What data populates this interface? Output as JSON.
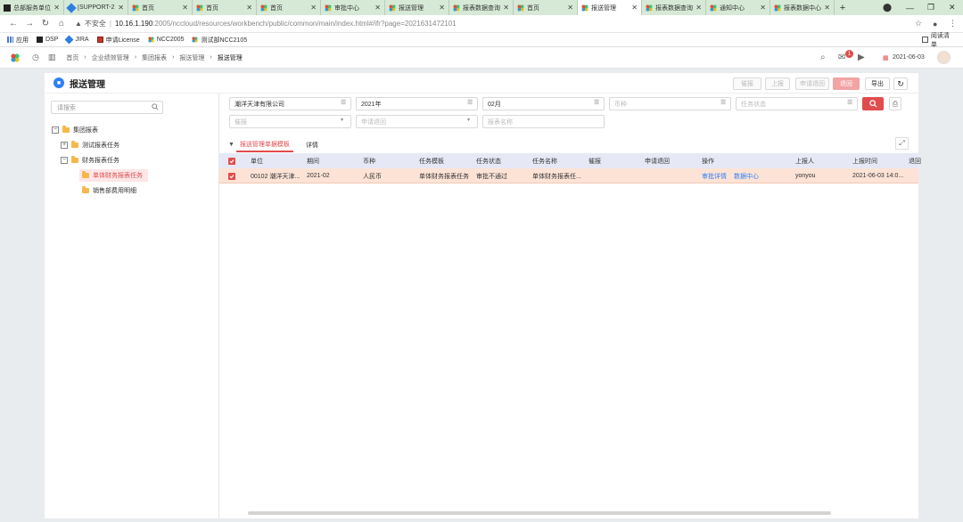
{
  "browser": {
    "tabs": [
      {
        "label": "总部服务单位",
        "icon": "dark-app-icon",
        "active": false
      },
      {
        "label": "[SUPPORT-2",
        "icon": "jira-icon",
        "active": false
      },
      {
        "label": "首页",
        "icon": "ncc-flower-icon",
        "active": false
      },
      {
        "label": "首页",
        "icon": "ncc-flower-icon",
        "active": false
      },
      {
        "label": "首页",
        "icon": "ncc-flower-icon",
        "active": false
      },
      {
        "label": "审批中心",
        "icon": "ncc-flower-icon",
        "active": false
      },
      {
        "label": "报送管理",
        "icon": "ncc-flower-icon",
        "active": false
      },
      {
        "label": "报表数据查询",
        "icon": "ncc-flower-icon",
        "active": false
      },
      {
        "label": "首页",
        "icon": "ncc-flower-icon",
        "active": false
      },
      {
        "label": "报送管理",
        "icon": "ncc-flower-icon",
        "active": true
      },
      {
        "label": "报表数据查询",
        "icon": "ncc-flower-icon",
        "active": false
      },
      {
        "label": "通知中心",
        "icon": "ncc-flower-icon",
        "active": false
      },
      {
        "label": "报表数据中心",
        "icon": "ncc-flower-icon",
        "active": false
      }
    ],
    "address": {
      "security_label": "不安全",
      "host": "10.16.1.190",
      "path": ":2005/nccloud/resources/workbench/public/common/main/index.html#/ifr?page=2021631472101"
    },
    "bookmarks": [
      {
        "label": "应用",
        "icon": "apps-grid-icon"
      },
      {
        "label": "DSP",
        "icon": "dark-app-icon"
      },
      {
        "label": "JIRA",
        "icon": "jira-icon"
      },
      {
        "label": "申请License",
        "icon": "license-icon"
      },
      {
        "label": "NCC2005",
        "icon": "ncc-flower-icon"
      },
      {
        "label": "测试部NCC2105",
        "icon": "ncc-flower-icon"
      }
    ],
    "reading_list": "阅读清单"
  },
  "app_header": {
    "breadcrumbs": [
      "首页",
      "企业绩效管理",
      "集团报表",
      "报送管理",
      "报送管理"
    ],
    "notification_count": "1",
    "date": "2021-06-03"
  },
  "page": {
    "title": "报送管理",
    "buttons": {
      "approve": "催报",
      "report": "上报",
      "request_return": "申请退回",
      "return": "退回",
      "export": "导出"
    }
  },
  "tree": {
    "search_placeholder": "请搜索",
    "root": "集团报表",
    "nodes": [
      {
        "label": "测试报表任务",
        "level": 1,
        "toggle": "+"
      },
      {
        "label": "财务报表任务",
        "level": 1,
        "toggle": "−"
      },
      {
        "label": "单体财务报表任务",
        "level": 2,
        "selected": true
      },
      {
        "label": "销售部费用明细",
        "level": 2,
        "selected": false
      }
    ]
  },
  "filters": {
    "org": "潮洋天津有限公司",
    "year": "2021年",
    "month": "02月",
    "currency_placeholder": "币种",
    "task_status_placeholder": "任务状态",
    "other_placeholder": "催报",
    "request_return_placeholder": "申请退回",
    "report_name_placeholder": "报表名称"
  },
  "tabs": {
    "active": "报送管理单据模板",
    "detail": "详情"
  },
  "grid": {
    "columns": [
      "单位",
      "期间",
      "币种",
      "任务模板",
      "任务状态",
      "任务名称",
      "催报",
      "申请退回",
      "操作",
      "上报人",
      "上报时间",
      "退回"
    ],
    "rows": [
      {
        "unit": "00102 潮洋天津...",
        "period": "2021-02",
        "currency": "人民币",
        "template": "单体财务报表任务",
        "status": "审批不通过",
        "name": "单体财务报表任...",
        "urge": "",
        "request_return": "",
        "action_1": "审批详情",
        "action_2": "数据中心",
        "reporter": "yonyou",
        "report_time": "2021-06-03 14:0..."
      }
    ]
  }
}
